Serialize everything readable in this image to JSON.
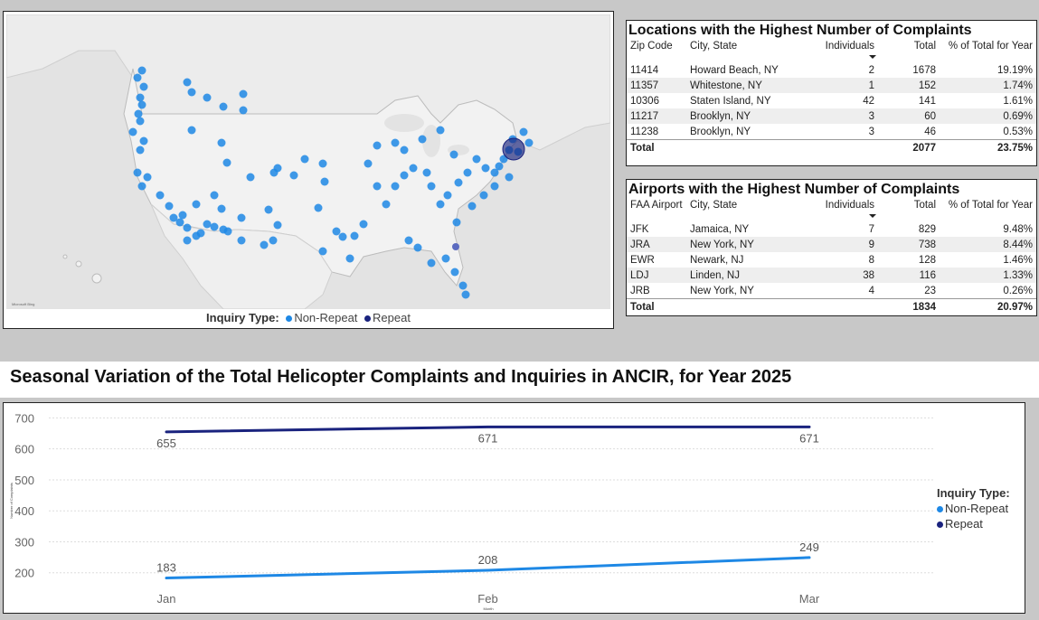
{
  "map": {
    "legend_title": "Inquiry Type:",
    "legend_items": [
      {
        "label": "Non-Repeat",
        "color": "#1e88e5"
      },
      {
        "label": "Repeat",
        "color": "#1a237e"
      }
    ]
  },
  "locations_table": {
    "title": "Locations with the Highest Number of Complaints",
    "columns": [
      "Zip Code",
      "City, State",
      "Individuals",
      "Total",
      "% of Total for Year"
    ],
    "rows": [
      [
        "11414",
        "Howard Beach, NY",
        "2",
        "1678",
        "19.19%"
      ],
      [
        "11357",
        "Whitestone, NY",
        "1",
        "152",
        "1.74%"
      ],
      [
        "10306",
        "Staten Island, NY",
        "42",
        "141",
        "1.61%"
      ],
      [
        "11217",
        "Brooklyn, NY",
        "3",
        "60",
        "0.69%"
      ],
      [
        "11238",
        "Brooklyn, NY",
        "3",
        "46",
        "0.53%"
      ]
    ],
    "total": [
      "Total",
      "",
      "",
      "2077",
      "23.75%"
    ]
  },
  "airports_table": {
    "title": "Airports with the Highest Number of Complaints",
    "columns": [
      "FAA Airport",
      "City, State",
      "Individuals",
      "Total",
      "% of Total for Year"
    ],
    "rows": [
      [
        "JFK",
        "Jamaica, NY",
        "7",
        "829",
        "9.48%"
      ],
      [
        "JRA",
        "New York, NY",
        "9",
        "738",
        "8.44%"
      ],
      [
        "EWR",
        "Newark, NJ",
        "8",
        "128",
        "1.46%"
      ],
      [
        "LDJ",
        "Linden, NJ",
        "38",
        "116",
        "1.33%"
      ],
      [
        "JRB",
        "New York, NY",
        "4",
        "23",
        "0.26%"
      ]
    ],
    "total": [
      "Total",
      "",
      "",
      "1834",
      "20.97%"
    ]
  },
  "page_title": "Seasonal Variation of the Total Helicopter Complaints and Inquiries in ANCIR, for Year 2025",
  "chart_data": {
    "type": "line",
    "categories": [
      "Jan",
      "Feb",
      "Mar"
    ],
    "series": [
      {
        "name": "Non-Repeat",
        "values": [
          183,
          208,
          249
        ],
        "color": "#1e88e5"
      },
      {
        "name": "Repeat",
        "values": [
          655,
          671,
          671
        ],
        "color": "#1a237e"
      }
    ],
    "y_ticks": [
      700,
      600,
      500,
      400,
      300,
      200
    ],
    "ylim": [
      170,
      710
    ],
    "xlabel": "Month",
    "ylabel": "Number of Complaints",
    "legend_title": "Inquiry Type:",
    "legend_position": "right",
    "grid": true
  }
}
